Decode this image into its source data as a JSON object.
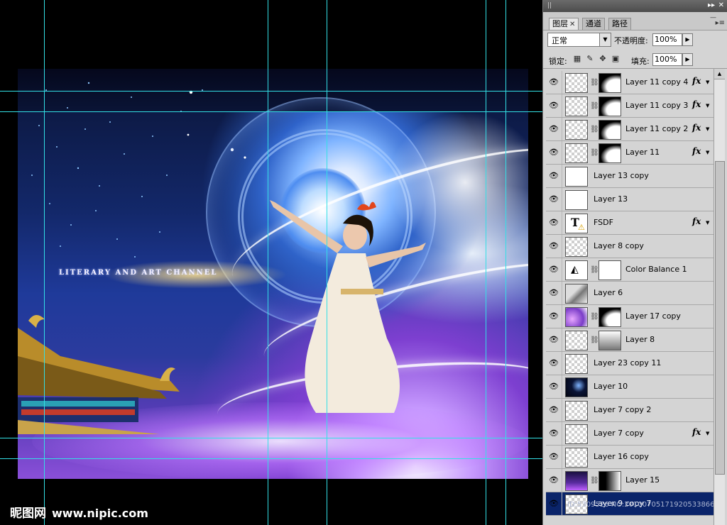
{
  "canvas": {
    "artwork_text": "LITERARY AND ART CHANNEL",
    "watermark_cn": "昵图网",
    "watermark_url": "www.nipic.com"
  },
  "panel": {
    "tabs": [
      {
        "label": "图层",
        "active": true
      },
      {
        "label": "通道",
        "active": false
      },
      {
        "label": "路径",
        "active": false
      }
    ],
    "blend_mode": "正常",
    "opacity_label": "不透明度:",
    "opacity_value": "100%",
    "lock_label": "锁定:",
    "fill_label": "填充:",
    "fill_value": "100%",
    "lock_icons": [
      "lock-transparent-icon",
      "lock-paint-icon",
      "lock-move-icon",
      "lock-all-icon"
    ],
    "layers": [
      {
        "name": "Layer 11 copy 4",
        "mask": true,
        "fx": true
      },
      {
        "name": "Layer 11 copy 3",
        "mask": true,
        "fx": true
      },
      {
        "name": "Layer 11 copy 2",
        "mask": true,
        "fx": true
      },
      {
        "name": "Layer 11",
        "mask": true,
        "fx": true
      },
      {
        "name": "Layer 13 copy",
        "mask": false,
        "fx": false
      },
      {
        "name": "Layer 13",
        "mask": false,
        "fx": false
      },
      {
        "name": "FSDF",
        "mask": false,
        "fx": true,
        "type": "text"
      },
      {
        "name": "Layer 8 copy",
        "mask": false,
        "fx": false
      },
      {
        "name": "Color Balance 1",
        "mask": true,
        "fx": false,
        "type": "adjustment"
      },
      {
        "name": "Layer 6",
        "mask": false,
        "fx": false
      },
      {
        "name": "Layer 17 copy",
        "mask": true,
        "fx": false
      },
      {
        "name": "Layer 8",
        "mask": true,
        "fx": false
      },
      {
        "name": "Layer 23 copy 11",
        "mask": false,
        "fx": false
      },
      {
        "name": "Layer 10",
        "mask": false,
        "fx": false
      },
      {
        "name": "Layer 7 copy 2",
        "mask": false,
        "fx": false
      },
      {
        "name": "Layer 7 copy",
        "mask": false,
        "fx": true
      },
      {
        "name": "Layer 16 copy",
        "mask": false,
        "fx": false
      },
      {
        "name": "Layer 15",
        "mask": true,
        "fx": false
      },
      {
        "name": "Layer 9 copy 7",
        "mask": false,
        "fx": false,
        "selected": true
      }
    ],
    "id_overlay": "ID:5309526 NO:20100705171920533866"
  },
  "colors": {
    "guide": "#33e0e6",
    "selection": "#0a246a",
    "panel_bg": "#d4d4d4"
  }
}
